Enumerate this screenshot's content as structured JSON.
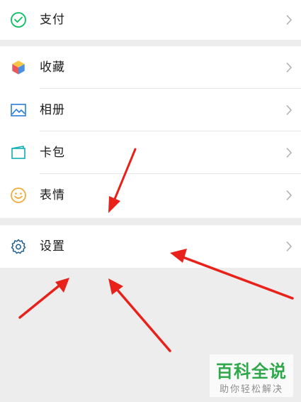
{
  "menu": {
    "pay": {
      "label": "支付",
      "icon": "wechat-pay-icon"
    },
    "favorites": {
      "label": "收藏",
      "icon": "favorites-cube-icon"
    },
    "album": {
      "label": "相册",
      "icon": "album-image-icon"
    },
    "cards": {
      "label": "卡包",
      "icon": "card-wallet-icon"
    },
    "stickers": {
      "label": "表情",
      "icon": "smiley-icon"
    },
    "settings": {
      "label": "设置",
      "icon": "gear-icon"
    }
  },
  "watermark": {
    "title": "百科全说",
    "subtitle": "助你轻松解决"
  },
  "colors": {
    "background": "#ededed",
    "row": "#ffffff",
    "arrow": "#e8211b",
    "pay_green": "#07c160",
    "album_blue": "#2a7ed6",
    "card_teal": "#10aeb5",
    "smiley_yellow": "#f0a830",
    "settings_blue": "#1f5d8f",
    "watermark_green": "#2ea84a"
  }
}
